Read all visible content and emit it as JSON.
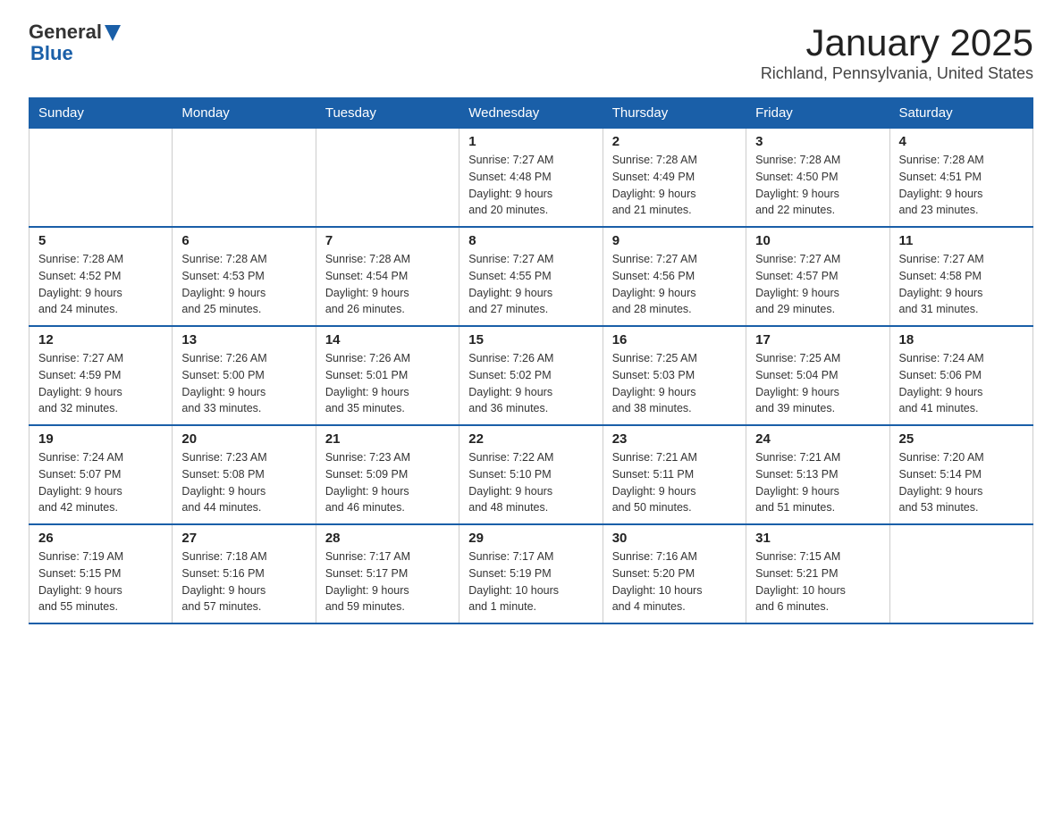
{
  "logo": {
    "text_general": "General",
    "text_blue": "Blue"
  },
  "header": {
    "title": "January 2025",
    "subtitle": "Richland, Pennsylvania, United States"
  },
  "weekdays": [
    "Sunday",
    "Monday",
    "Tuesday",
    "Wednesday",
    "Thursday",
    "Friday",
    "Saturday"
  ],
  "weeks": [
    [
      {
        "day": "",
        "info": ""
      },
      {
        "day": "",
        "info": ""
      },
      {
        "day": "",
        "info": ""
      },
      {
        "day": "1",
        "info": "Sunrise: 7:27 AM\nSunset: 4:48 PM\nDaylight: 9 hours\nand 20 minutes."
      },
      {
        "day": "2",
        "info": "Sunrise: 7:28 AM\nSunset: 4:49 PM\nDaylight: 9 hours\nand 21 minutes."
      },
      {
        "day": "3",
        "info": "Sunrise: 7:28 AM\nSunset: 4:50 PM\nDaylight: 9 hours\nand 22 minutes."
      },
      {
        "day": "4",
        "info": "Sunrise: 7:28 AM\nSunset: 4:51 PM\nDaylight: 9 hours\nand 23 minutes."
      }
    ],
    [
      {
        "day": "5",
        "info": "Sunrise: 7:28 AM\nSunset: 4:52 PM\nDaylight: 9 hours\nand 24 minutes."
      },
      {
        "day": "6",
        "info": "Sunrise: 7:28 AM\nSunset: 4:53 PM\nDaylight: 9 hours\nand 25 minutes."
      },
      {
        "day": "7",
        "info": "Sunrise: 7:28 AM\nSunset: 4:54 PM\nDaylight: 9 hours\nand 26 minutes."
      },
      {
        "day": "8",
        "info": "Sunrise: 7:27 AM\nSunset: 4:55 PM\nDaylight: 9 hours\nand 27 minutes."
      },
      {
        "day": "9",
        "info": "Sunrise: 7:27 AM\nSunset: 4:56 PM\nDaylight: 9 hours\nand 28 minutes."
      },
      {
        "day": "10",
        "info": "Sunrise: 7:27 AM\nSunset: 4:57 PM\nDaylight: 9 hours\nand 29 minutes."
      },
      {
        "day": "11",
        "info": "Sunrise: 7:27 AM\nSunset: 4:58 PM\nDaylight: 9 hours\nand 31 minutes."
      }
    ],
    [
      {
        "day": "12",
        "info": "Sunrise: 7:27 AM\nSunset: 4:59 PM\nDaylight: 9 hours\nand 32 minutes."
      },
      {
        "day": "13",
        "info": "Sunrise: 7:26 AM\nSunset: 5:00 PM\nDaylight: 9 hours\nand 33 minutes."
      },
      {
        "day": "14",
        "info": "Sunrise: 7:26 AM\nSunset: 5:01 PM\nDaylight: 9 hours\nand 35 minutes."
      },
      {
        "day": "15",
        "info": "Sunrise: 7:26 AM\nSunset: 5:02 PM\nDaylight: 9 hours\nand 36 minutes."
      },
      {
        "day": "16",
        "info": "Sunrise: 7:25 AM\nSunset: 5:03 PM\nDaylight: 9 hours\nand 38 minutes."
      },
      {
        "day": "17",
        "info": "Sunrise: 7:25 AM\nSunset: 5:04 PM\nDaylight: 9 hours\nand 39 minutes."
      },
      {
        "day": "18",
        "info": "Sunrise: 7:24 AM\nSunset: 5:06 PM\nDaylight: 9 hours\nand 41 minutes."
      }
    ],
    [
      {
        "day": "19",
        "info": "Sunrise: 7:24 AM\nSunset: 5:07 PM\nDaylight: 9 hours\nand 42 minutes."
      },
      {
        "day": "20",
        "info": "Sunrise: 7:23 AM\nSunset: 5:08 PM\nDaylight: 9 hours\nand 44 minutes."
      },
      {
        "day": "21",
        "info": "Sunrise: 7:23 AM\nSunset: 5:09 PM\nDaylight: 9 hours\nand 46 minutes."
      },
      {
        "day": "22",
        "info": "Sunrise: 7:22 AM\nSunset: 5:10 PM\nDaylight: 9 hours\nand 48 minutes."
      },
      {
        "day": "23",
        "info": "Sunrise: 7:21 AM\nSunset: 5:11 PM\nDaylight: 9 hours\nand 50 minutes."
      },
      {
        "day": "24",
        "info": "Sunrise: 7:21 AM\nSunset: 5:13 PM\nDaylight: 9 hours\nand 51 minutes."
      },
      {
        "day": "25",
        "info": "Sunrise: 7:20 AM\nSunset: 5:14 PM\nDaylight: 9 hours\nand 53 minutes."
      }
    ],
    [
      {
        "day": "26",
        "info": "Sunrise: 7:19 AM\nSunset: 5:15 PM\nDaylight: 9 hours\nand 55 minutes."
      },
      {
        "day": "27",
        "info": "Sunrise: 7:18 AM\nSunset: 5:16 PM\nDaylight: 9 hours\nand 57 minutes."
      },
      {
        "day": "28",
        "info": "Sunrise: 7:17 AM\nSunset: 5:17 PM\nDaylight: 9 hours\nand 59 minutes."
      },
      {
        "day": "29",
        "info": "Sunrise: 7:17 AM\nSunset: 5:19 PM\nDaylight: 10 hours\nand 1 minute."
      },
      {
        "day": "30",
        "info": "Sunrise: 7:16 AM\nSunset: 5:20 PM\nDaylight: 10 hours\nand 4 minutes."
      },
      {
        "day": "31",
        "info": "Sunrise: 7:15 AM\nSunset: 5:21 PM\nDaylight: 10 hours\nand 6 minutes."
      },
      {
        "day": "",
        "info": ""
      }
    ]
  ]
}
